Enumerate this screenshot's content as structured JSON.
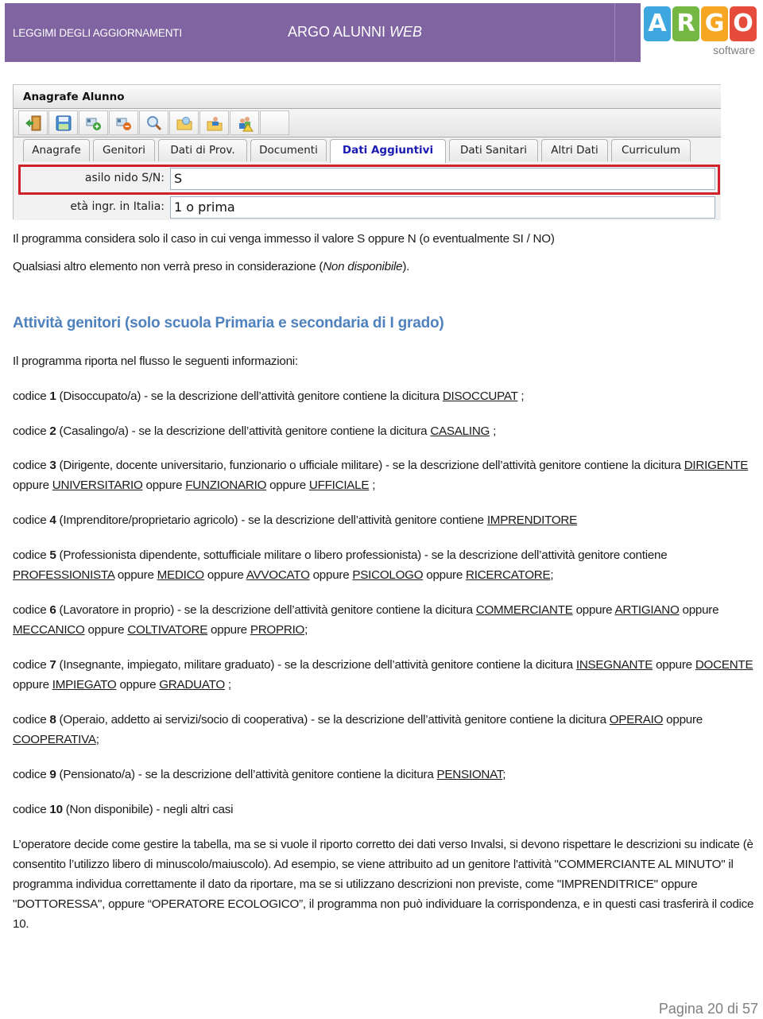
{
  "header": {
    "left_label": "LEGGIMI DEGLI AGGIORNAMENTI",
    "title_main": "ARGO ALUNNI ",
    "title_italic": "WEB",
    "brand_color": "#8064a2",
    "logo": {
      "letters": [
        "A",
        "R",
        "G",
        "O"
      ],
      "tile_colors": [
        "#3ea7e0",
        "#74b843",
        "#f5a623",
        "#e64c3c"
      ],
      "subtitle": "software"
    }
  },
  "app_screenshot": {
    "window_title": "Anagrafe Alunno",
    "toolbar": [
      {
        "icon": "exit-door-icon"
      },
      {
        "icon": "save-floppy-icon"
      },
      {
        "icon": "add-record-icon"
      },
      {
        "icon": "remove-record-icon"
      },
      {
        "icon": "search-magnifier-icon"
      },
      {
        "icon": "open-folder-icon"
      },
      {
        "icon": "folder-user-icon"
      },
      {
        "icon": "users-warning-icon"
      }
    ],
    "tabs": [
      {
        "label": "Anagrafe",
        "active": false
      },
      {
        "label": "Genitori",
        "active": false
      },
      {
        "label": "Dati di Prov.",
        "active": false
      },
      {
        "label": "Documenti",
        "active": false
      },
      {
        "label": "Dati Aggiuntivi",
        "active": true
      },
      {
        "label": "Dati Sanitari",
        "active": false
      },
      {
        "label": "Altri Dati",
        "active": false
      },
      {
        "label": "Curriculum",
        "active": false
      }
    ],
    "fields": [
      {
        "label": "asilo nido S/N:",
        "value": "S",
        "highlighted": true
      },
      {
        "label": "età ingr. in Italia:",
        "value": "1 o prima",
        "highlighted": false
      }
    ],
    "highlight_color": "#d0202a"
  },
  "intro": {
    "p1": "Il programma considera solo il caso in cui venga immesso il valore S oppure N (o eventualmente SI / NO)",
    "p2_text": "Qualsiasi altro elemento non verrà preso in considerazione (",
    "p2_italic": "Non disponibile",
    "p2_end": ")."
  },
  "section": {
    "heading": "Attività genitori (solo scuola Primaria e secondaria di I grado)",
    "heading_color": "#4f81bd",
    "lead": "Il programma riporta nel flusso le seguenti informazioni:",
    "codes": [
      {
        "prefix": "codice ",
        "num": "1",
        "desc": " (Disoccupato/a) - se la descrizione dell’attività genitore contiene la dicitura ",
        "keywords": [
          "DISOCCUPAT"
        ],
        "joiner": " oppure ",
        "end": " ;"
      },
      {
        "prefix": "codice ",
        "num": "2",
        "desc": " (Casalingo/a) - se la descrizione dell’attività genitore contiene la dicitura ",
        "keywords": [
          "CASALING"
        ],
        "joiner": " oppure ",
        "end": " ;"
      },
      {
        "prefix": "codice ",
        "num": "3",
        "desc": "  (Dirigente, docente universitario, funzionario o ufficiale militare) - se la descrizione dell’attività genitore contiene la dicitura ",
        "keywords": [
          "DIRIGENTE",
          "UNIVERSITARIO",
          "FUNZIONARIO",
          "UFFICIALE"
        ],
        "joiner": " oppure ",
        "end": " ;"
      },
      {
        "prefix": "codice ",
        "num": "4",
        "desc": " (Imprenditore/proprietario agricolo) -  se la descrizione dell’attività genitore contiene ",
        "keywords": [
          "IMPRENDITORE"
        ],
        "joiner": " oppure ",
        "end": ""
      },
      {
        "prefix": "codice ",
        "num": "5",
        "desc": " (Professionista dipendente, sottufficiale militare o libero professionista) - se la descrizione dell’attività genitore contiene ",
        "keywords": [
          "PROFESSIONISTA",
          "MEDICO",
          "AVVOCATO",
          "PSICOLOGO",
          "RICERCATORE"
        ],
        "joiner": " oppure ",
        "end": ";"
      },
      {
        "prefix": "codice ",
        "num": "6",
        "desc": "  (Lavoratore in proprio) - se la descrizione dell’attività genitore contiene la dicitura ",
        "keywords": [
          "COMMERCIANTE",
          "ARTIGIANO",
          "MECCANICO",
          "COLTIVATORE",
          "PROPRIO"
        ],
        "joiner": " oppure ",
        "end": ";"
      },
      {
        "prefix": "codice ",
        "num": "7",
        "desc": "  (Insegnante, impiegato, militare graduato) - se la descrizione dell’attività genitore contiene la dicitura ",
        "keywords": [
          "INSEGNANTE",
          "DOCENTE",
          "IMPIEGATO",
          "GRADUATO"
        ],
        "joiner": " oppure ",
        "end": " ;"
      },
      {
        "prefix": "codice ",
        "num": "8",
        "desc": "  (Operaio, addetto ai servizi/socio di cooperativa) - se la descrizione dell’attività genitore contiene la dicitura ",
        "keywords": [
          "OPERAIO",
          "COOPERATIVA"
        ],
        "joiner": " oppure ",
        "end": ";"
      },
      {
        "prefix": "codice ",
        "num": "9",
        "desc": "  (Pensionato/a) - se la descrizione dell’attività genitore contiene la dicitura ",
        "keywords": [
          "PENSIONAT"
        ],
        "joiner": " oppure ",
        "end": ";"
      },
      {
        "prefix": "codice ",
        "num": "10",
        "desc": "  (Non disponibile) - negli altri casi",
        "keywords": [],
        "joiner": "",
        "end": ""
      }
    ],
    "closing": "L’operatore decide come gestire la tabella, ma se si vuole il riporto corretto dei dati verso Invalsi, si devono rispettare le descrizioni su indicate (è consentito l’utilizzo libero di minuscolo/maiuscolo). Ad esempio, se viene attribuito ad un genitore l'attività \"COMMERCIANTE AL MINUTO\" il programma individua correttamente il dato da riportare, ma se si utilizzano descrizioni non previste, come \"IMPRENDITRICE\" oppure \"DOTTORESSA\", oppure “OPERATORE ECOLOGICO”, il programma non può individuare la corrispondenza, e in questi casi trasferirà  il codice 10."
  },
  "footer": {
    "page_label": "Pagina 20 di 57"
  }
}
